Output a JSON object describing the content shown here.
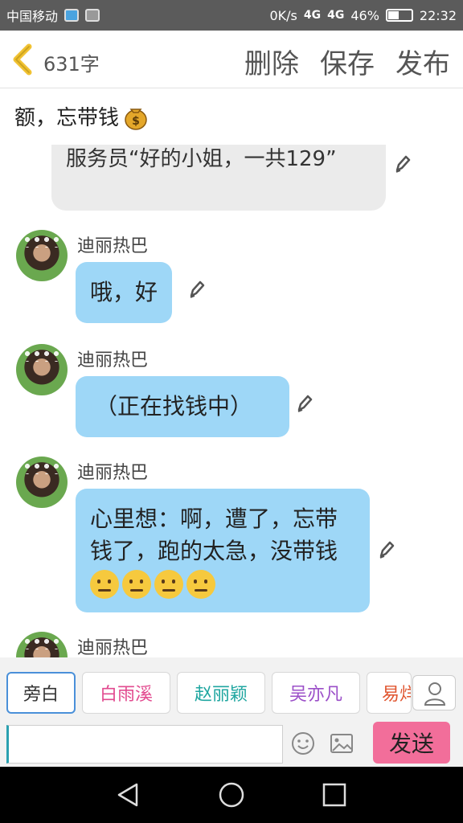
{
  "status_bar": {
    "carrier": "中国移动",
    "speed": "0K/s",
    "network": "4G",
    "network2": "4G",
    "battery": "46%",
    "time": "22:32"
  },
  "top_bar": {
    "word_count": "631字",
    "delete_label": "删除",
    "save_label": "保存",
    "publish_label": "发布"
  },
  "messages": {
    "narration_text": "额，忘带钱",
    "narration_bubble_text": "服务员“好的小姐，一共129”",
    "items": [
      {
        "name": "迪丽热巴",
        "text": "哦，好"
      },
      {
        "name": "迪丽热巴",
        "text": "（正在找钱中）"
      },
      {
        "name": "迪丽热巴",
        "text": "心里想：啊，遭了，忘带钱了，跑的太急，没带钱"
      },
      {
        "name": "迪丽热巴"
      }
    ]
  },
  "characters": {
    "items": [
      {
        "label": "旁白",
        "color": "#333333"
      },
      {
        "label": "白雨溪",
        "color": "#e24a8f"
      },
      {
        "label": "赵丽颖",
        "color": "#1fa6a0"
      },
      {
        "label": "吴亦凡",
        "color": "#9b4fc8"
      },
      {
        "label": "易烊",
        "color": "#e0542e"
      }
    ]
  },
  "composer": {
    "input_value": "",
    "send_label": "发送"
  },
  "colors": {
    "accent_blue": "#9ed7f7",
    "send_pink": "#f26e9a",
    "status_bar_bg": "#5b5b5b"
  }
}
